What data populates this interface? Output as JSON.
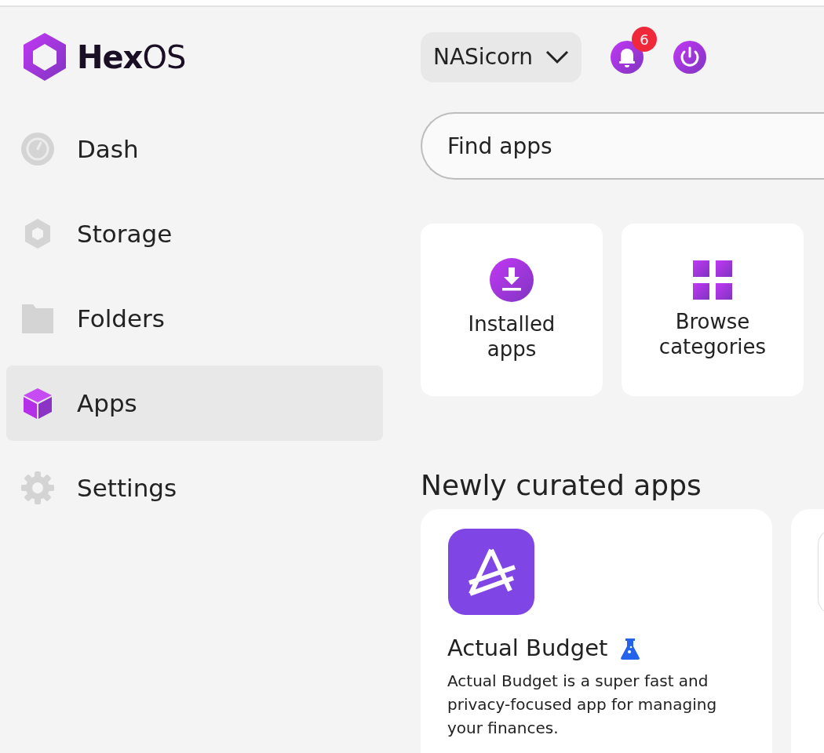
{
  "logo": {
    "text": "**Hex**OS"
  },
  "sidebar": {
    "items": [
      {
        "kind": "dash",
        "label": "Dash",
        "selected": false
      },
      {
        "kind": "storage",
        "label": "Storage",
        "selected": false
      },
      {
        "kind": "folders",
        "label": "Folders",
        "selected": false
      },
      {
        "kind": "apps",
        "label": "Apps",
        "selected": true
      },
      {
        "kind": "settings",
        "label": "Settings",
        "selected": false
      }
    ]
  },
  "header": {
    "server": "NASicorn",
    "notification_count": "6"
  },
  "search": {
    "placeholder": "Find apps"
  },
  "shortcuts": [
    {
      "kind": "installed",
      "label": "Installed apps"
    },
    {
      "kind": "browse",
      "label": "Browse categories"
    }
  ],
  "section_title": "Newly curated apps",
  "apps": [
    {
      "name": "Actual Budget",
      "beta": true,
      "description": "Actual Budget is a super fast and privacy-focused app for managing your finances."
    }
  ]
}
